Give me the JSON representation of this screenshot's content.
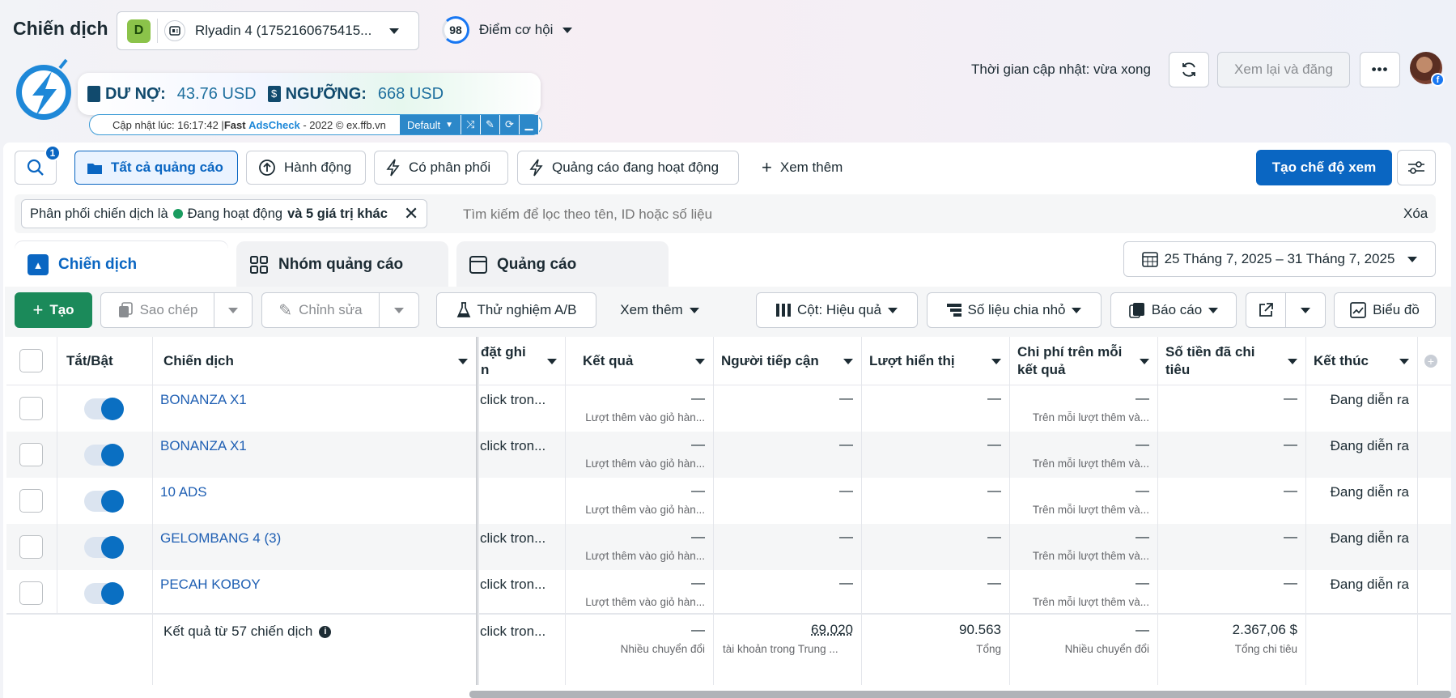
{
  "header": {
    "title": "Chiến dịch",
    "account_badge": "D",
    "account_name": "Rlyadin 4 (1752160675415...",
    "score": "98",
    "score_label": "Điểm cơ hội",
    "update_time": "Thời gian cập nhật: vừa xong",
    "review_button": "Xem lại và đăng"
  },
  "adscheck": {
    "debt_label": "DƯ NỢ:",
    "debt_value": "43.76 USD",
    "threshold_label": "NGƯỠNG:",
    "threshold_value": "668 USD",
    "info_prefix": "Cập nhật lúc: 16:17:42 | ",
    "info_brand1": "Fast ",
    "info_brand2": "AdsCheck",
    "info_suffix": " - 2022 © ex.ffb.vn",
    "mode": "Default"
  },
  "filters": {
    "search_badge": "1",
    "items": [
      "Tất cả quảng cáo",
      "Hành động",
      "Có phân phối",
      "Quảng cáo đang hoạt động",
      "Xem thêm"
    ],
    "create_view": "Tạo chế độ xem",
    "chip_prefix": "Phân phối chiến dịch là",
    "chip_status": "Đang hoạt động",
    "chip_more": "và 5 giá trị khác",
    "search_placeholder": "Tìm kiếm để lọc theo tên, ID hoặc số liệu",
    "clear": "Xóa"
  },
  "tabs": [
    "Chiến dịch",
    "Nhóm quảng cáo",
    "Quảng cáo"
  ],
  "date_range": "25 Tháng 7, 2025 – 31 Tháng 7, 2025",
  "toolbar": {
    "create": "Tạo",
    "copy": "Sao chép",
    "edit": "Chỉnh sửa",
    "ab_test": "Thử nghiệm A/B",
    "more": "Xem thêm",
    "columns": "Cột: Hiệu quả",
    "breakdown": "Số liệu chia nhỏ",
    "reports": "Báo cáo",
    "chart": "Biểu đồ"
  },
  "table": {
    "headers": {
      "toggle": "Tắt/Bật",
      "campaign": "Chiến dịch",
      "attribution_1": "đặt ghi",
      "attribution_2": "n",
      "results": "Kết quả",
      "reach": "Người tiếp cận",
      "impressions": "Lượt hiển thị",
      "cpr_1": "Chi phí trên mỗi",
      "cpr_2": "kết quả",
      "spent_1": "Số tiền đã chi",
      "spent_2": "tiêu",
      "end": "Kết thúc"
    },
    "rows": [
      {
        "name": "BONANZA X1",
        "attr": "click tron...",
        "result": "—",
        "result_sub": "Lượt thêm vào giỏ hàn...",
        "reach": "—",
        "impr": "—",
        "cpr": "—",
        "cpr_sub": "Trên mỗi lượt thêm và...",
        "spent": "—",
        "end": "Đang diễn ra"
      },
      {
        "name": "BONANZA X1",
        "attr": "click tron...",
        "result": "—",
        "result_sub": "Lượt thêm vào giỏ hàn...",
        "reach": "—",
        "impr": "—",
        "cpr": "—",
        "cpr_sub": "Trên mỗi lượt thêm và...",
        "spent": "—",
        "end": "Đang diễn ra"
      },
      {
        "name": "10 ADS",
        "attr": "",
        "result": "—",
        "result_sub": "Lượt thêm vào giỏ hàn...",
        "reach": "—",
        "impr": "—",
        "cpr": "—",
        "cpr_sub": "Trên mỗi lượt thêm và...",
        "spent": "—",
        "end": "Đang diễn ra"
      },
      {
        "name": "GELOMBANG 4 (3)",
        "attr": "click tron...",
        "result": "—",
        "result_sub": "Lượt thêm vào giỏ hàn...",
        "reach": "—",
        "impr": "—",
        "cpr": "—",
        "cpr_sub": "Trên mỗi lượt thêm và...",
        "spent": "—",
        "end": "Đang diễn ra"
      },
      {
        "name": "PECAH KOBOY",
        "attr": "click tron...",
        "result": "—",
        "result_sub": "Lượt thêm vào giỏ hàn...",
        "reach": "—",
        "impr": "—",
        "cpr": "—",
        "cpr_sub": "Trên mỗi lượt thêm và...",
        "spent": "—",
        "end": "Đang diễn ra"
      }
    ],
    "summary": {
      "label": "Kết quả từ 57 chiến dịch",
      "attr": "click tron...",
      "result": "—",
      "result_sub": "Nhiều chuyển đổi",
      "reach": "69.020",
      "reach_sub": "tài khoản trong Trung ...",
      "impr": "90.563",
      "impr_sub": "Tổng",
      "cpr": "—",
      "cpr_sub": "Nhiều chuyển đổi",
      "spent": "2.367,06 $",
      "spent_sub": "Tổng chi tiêu"
    }
  }
}
